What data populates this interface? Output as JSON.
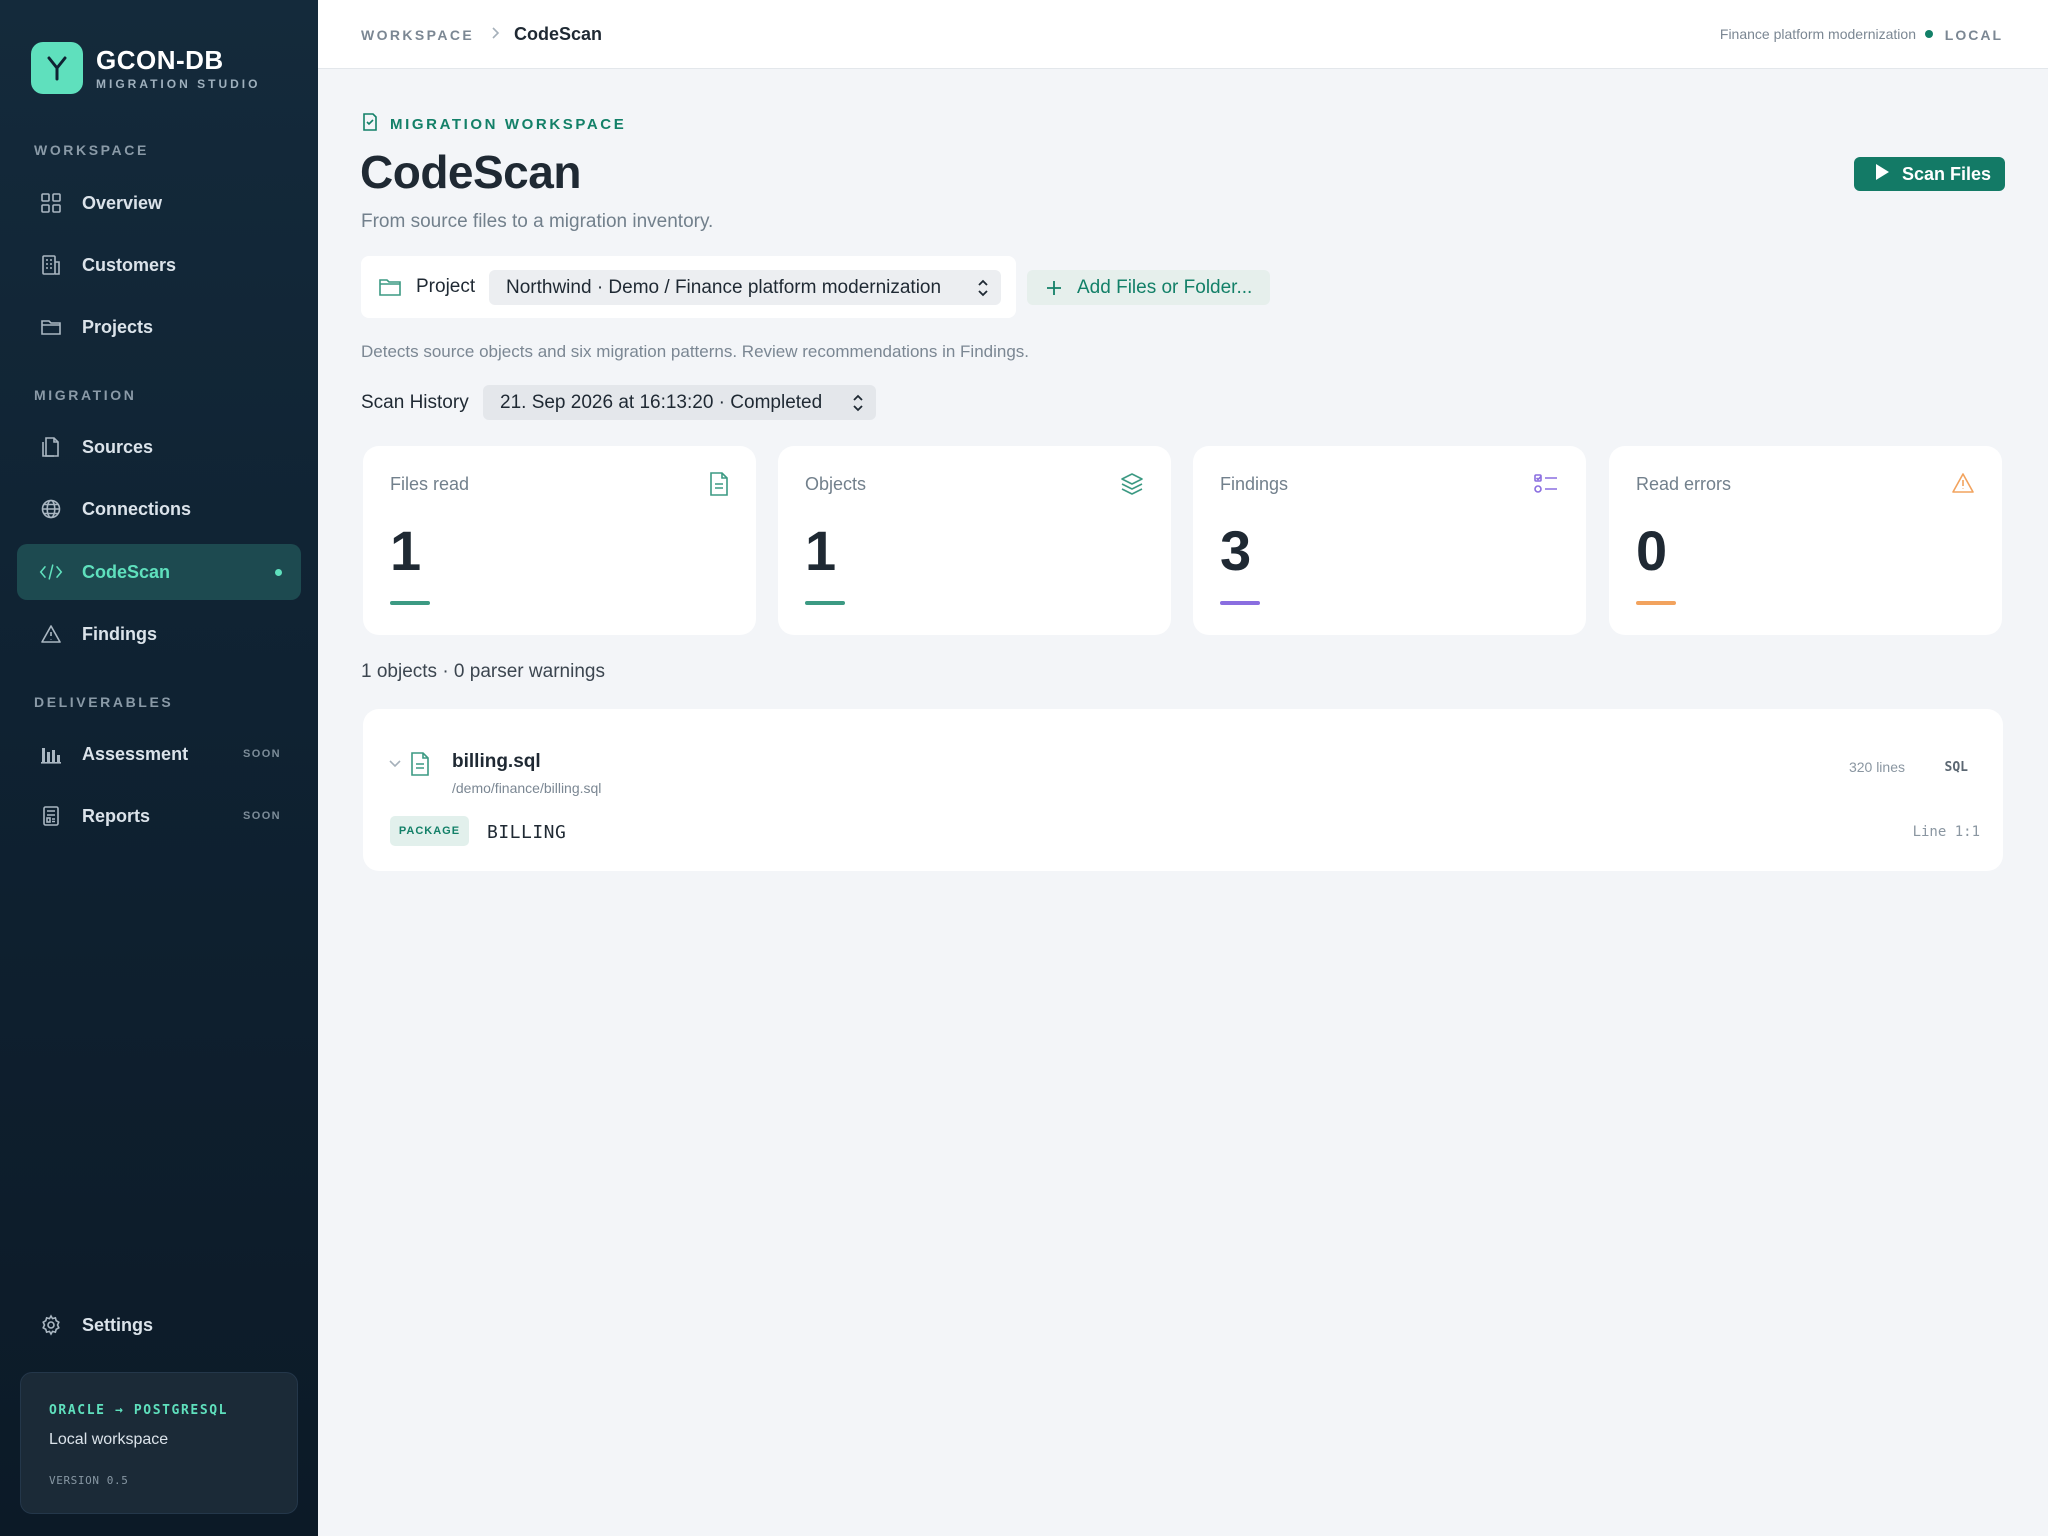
{
  "brand": {
    "name": "GCON-DB",
    "subtitle": "MIGRATION STUDIO"
  },
  "sidebar": {
    "sections": {
      "workspace": "WORKSPACE",
      "migration": "MIGRATION",
      "deliverables": "DELIVERABLES"
    },
    "items": [
      {
        "label": "Overview",
        "icon": "grid-icon"
      },
      {
        "label": "Customers",
        "icon": "building-icon"
      },
      {
        "label": "Projects",
        "icon": "folder-icon"
      },
      {
        "label": "Sources",
        "icon": "files-icon"
      },
      {
        "label": "Connections",
        "icon": "globe-icon"
      },
      {
        "label": "CodeScan",
        "icon": "code-icon",
        "active": true
      },
      {
        "label": "Findings",
        "icon": "warning-triangle-icon"
      },
      {
        "label": "Assessment",
        "icon": "bar-chart-icon",
        "badge": "SOON"
      },
      {
        "label": "Reports",
        "icon": "report-icon",
        "badge": "SOON"
      }
    ],
    "settings_label": "Settings",
    "env": {
      "title": "ORACLE → POSTGRESQL",
      "subtitle": "Local workspace",
      "version": "VERSION 0.5"
    }
  },
  "topbar": {
    "breadcrumb_root": "WORKSPACE",
    "breadcrumb_current": "CodeScan",
    "project": "Finance platform modernization",
    "mode": "LOCAL"
  },
  "main": {
    "eyebrow": "MIGRATION WORKSPACE",
    "title": "CodeScan",
    "subtitle": "From source files to a migration inventory.",
    "scan_button": "Scan Files",
    "project_label": "Project",
    "project_value": "Northwind · Demo / Finance platform modernization",
    "add_button": "Add Files or Folder...",
    "hint": "Detects source objects and six migration patterns. Review recommendations in Findings.",
    "history_label": "Scan History",
    "history_value": "21. Sep 2026 at 16:13:20 · Completed",
    "stats": [
      {
        "label": "Files read",
        "value": "1",
        "icon": "file-icon",
        "color": "#3c9a83"
      },
      {
        "label": "Objects",
        "value": "1",
        "icon": "layers-icon",
        "color": "#3c9a83"
      },
      {
        "label": "Findings",
        "value": "3",
        "icon": "checklist-icon",
        "color": "#8a6ee0"
      },
      {
        "label": "Read errors",
        "value": "0",
        "icon": "warning-icon",
        "color": "#f2a35e"
      }
    ],
    "summary": "1 objects · 0 parser warnings",
    "file": {
      "name": "billing.sql",
      "path": "/demo/finance/billing.sql",
      "lines": "320 lines",
      "lang": "SQL",
      "objects": [
        {
          "type": "PACKAGE",
          "name": "BILLING",
          "location": "Line 1:1"
        }
      ]
    }
  }
}
